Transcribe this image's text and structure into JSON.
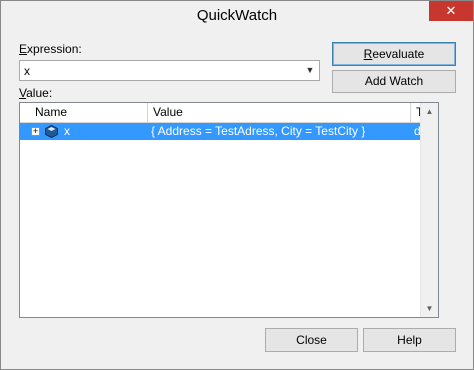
{
  "window": {
    "title": "QuickWatch",
    "close_glyph": "✕"
  },
  "expression": {
    "label": "Expression:",
    "value": "x"
  },
  "buttons": {
    "reevaluate": "Reevaluate",
    "add_watch": "Add Watch",
    "close": "Close",
    "help": "Help"
  },
  "value": {
    "label": "Value:",
    "columns": [
      "Name",
      "Value",
      "Type"
    ],
    "rows": [
      {
        "expander": "+",
        "icon": "object-icon",
        "name": "x",
        "value": "{ Address = TestAdress, City = TestCity }",
        "type": "dyna"
      }
    ]
  },
  "colors": {
    "selection": "#3399ff",
    "close_button": "#c7372f"
  }
}
